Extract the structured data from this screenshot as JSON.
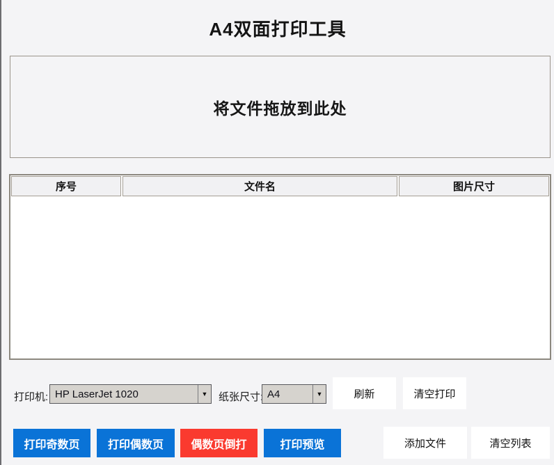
{
  "window": {
    "title": "A4双面打印工具"
  },
  "dropzone": {
    "label": "将文件拖放到此处"
  },
  "table": {
    "columns": [
      "序号",
      "文件名",
      "图片尺寸"
    ],
    "rows": []
  },
  "controls": {
    "printer_label": "打印机:",
    "printer_value": "HP LaserJet 1020",
    "paper_label": "纸张尺寸:",
    "paper_value": "A4",
    "refresh_label": "刷新",
    "clear_print_label": "清空打印"
  },
  "actions": {
    "print_odd_label": "打印奇数页",
    "print_even_label": "打印偶数页",
    "even_reverse_label": "偶数页倒打",
    "preview_label": "打印预览",
    "add_files_label": "添加文件",
    "clear_list_label": "清空列表"
  },
  "icons": {
    "dropdown_arrow": "▼"
  },
  "colors": {
    "accent_blue": "#0a73d7",
    "danger_red": "#fa3a2f",
    "button_white": "#ffffff"
  }
}
